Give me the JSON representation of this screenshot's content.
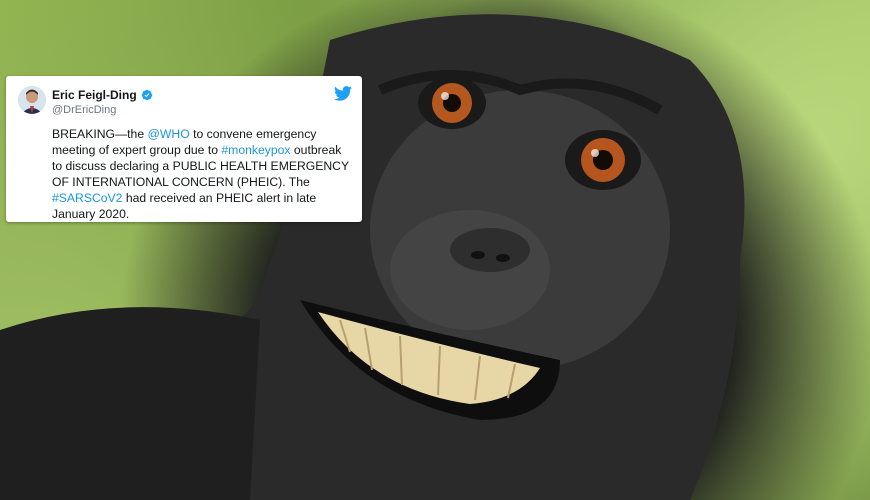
{
  "tweet": {
    "author_name": "Eric Feigl-Ding",
    "handle": "@DrEricDing",
    "text_1": "BREAKING—the ",
    "mention_who": "@WHO",
    "text_2": " to convene emergency meeting of expert group due to ",
    "hashtag_monkeypox": "#monkeypox",
    "text_3": " outbreak to discuss declaring a PUBLIC HEALTH EMERGENCY OF INTERNATIONAL CONCERN (PHEIC). The ",
    "hashtag_sarscov2": "#SARSCoV2",
    "text_4": " had received an PHEIC alert in late January 2020."
  },
  "icons": {
    "verified": "verified-badge-icon",
    "bird": "twitter-bird-icon"
  },
  "colors": {
    "link": "#1b95e0",
    "verified": "#1da1f2",
    "twitter_blue": "#1da1f2"
  }
}
